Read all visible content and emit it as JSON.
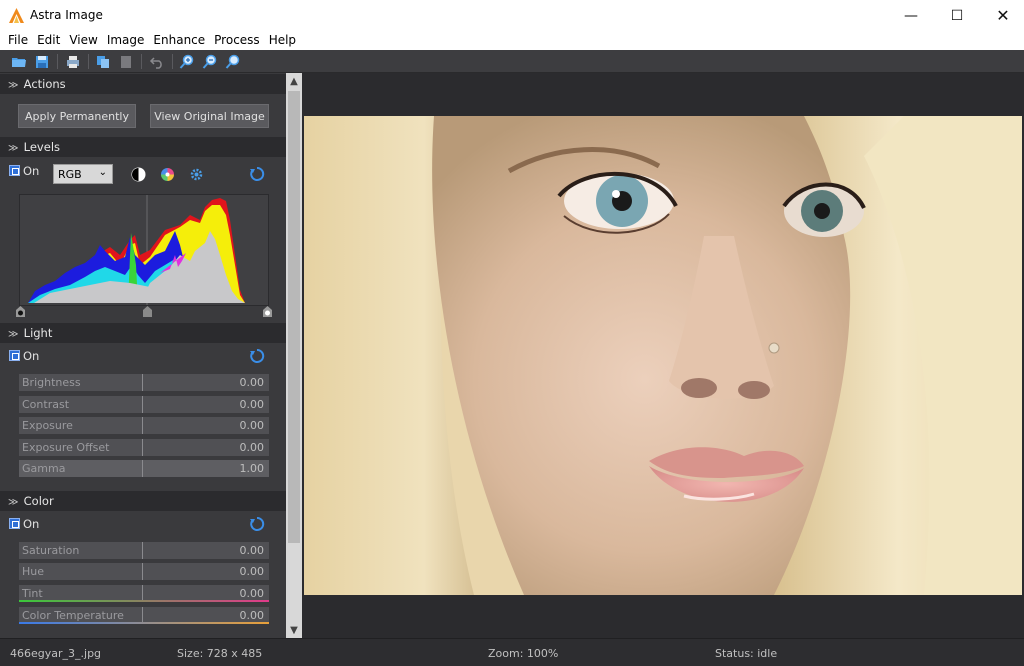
{
  "app": {
    "title": "Astra Image"
  },
  "window_controls": {
    "minimize": "—",
    "maximize": "☐",
    "close": "✕"
  },
  "menu": [
    "File",
    "Edit",
    "View",
    "Image",
    "Enhance",
    "Process",
    "Help"
  ],
  "toolbar": {
    "icons": [
      "open-folder-icon",
      "save-icon",
      "print-icon",
      "copy-icon",
      "delete-icon",
      "undo-icon",
      "zoom-in-icon",
      "zoom-out-icon",
      "zoom-fit-icon"
    ]
  },
  "panel": {
    "actions": {
      "header": "Actions",
      "apply_label": "Apply Permanently",
      "view_original_label": "View Original Image"
    },
    "levels": {
      "header": "Levels",
      "on_label": "On",
      "channel": "RGB"
    },
    "light": {
      "header": "Light",
      "on_label": "On",
      "sliders": [
        {
          "label": "Brightness",
          "value": "0.00"
        },
        {
          "label": "Contrast",
          "value": "0.00"
        },
        {
          "label": "Exposure",
          "value": "0.00"
        },
        {
          "label": "Exposure Offset",
          "value": "0.00"
        },
        {
          "label": "Gamma",
          "value": "1.00"
        }
      ]
    },
    "color": {
      "header": "Color",
      "on_label": "On",
      "sliders": [
        {
          "label": "Saturation",
          "value": "0.00"
        },
        {
          "label": "Hue",
          "value": "0.00"
        },
        {
          "label": "Tint",
          "value": "0.00"
        },
        {
          "label": "Color Temperature",
          "value": "0.00"
        }
      ]
    }
  },
  "status": {
    "filename": "466egyar_3_.jpg",
    "size": "Size: 728 x 485",
    "zoom": "Zoom: 100%",
    "state": "Status: idle"
  },
  "colors": {
    "accent": "#2f6fd6",
    "panel_bg": "#3a3a3d",
    "header_bg": "#2b2b2e"
  }
}
